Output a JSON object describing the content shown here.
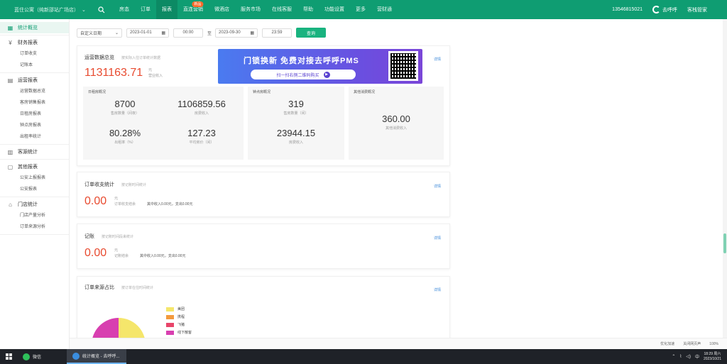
{
  "topbar": {
    "store": "蓝住公寓（纯新邵站广场店）",
    "nav": [
      {
        "label": "房态",
        "active": false,
        "badge": ""
      },
      {
        "label": "订单",
        "active": false,
        "badge": ""
      },
      {
        "label": "报表",
        "active": true,
        "badge": ""
      },
      {
        "label": "直连营销",
        "active": false,
        "badge": "新品"
      },
      {
        "label": "微酒店",
        "active": false,
        "badge": ""
      },
      {
        "label": "服务市场",
        "active": false,
        "badge": ""
      },
      {
        "label": "在线客服",
        "active": false,
        "badge": ""
      },
      {
        "label": "帮助",
        "active": false,
        "badge": ""
      },
      {
        "label": "功能设置",
        "active": false,
        "badge": ""
      },
      {
        "label": "更多",
        "active": false,
        "badge": ""
      },
      {
        "label": "营财通",
        "active": false,
        "badge": ""
      }
    ],
    "phone": "13546815021",
    "brand": "去呼呼",
    "user": "客栈管家"
  },
  "sidebar": {
    "groups": [
      {
        "label": "统计概览",
        "icon": "grid-icon",
        "glyph": "▦",
        "active": true,
        "items": []
      },
      {
        "label": "财务报表",
        "icon": "yen-icon",
        "glyph": "¥",
        "active": false,
        "items": [
          "订单收支",
          "记账本"
        ]
      },
      {
        "label": "运营报表",
        "icon": "chart-icon",
        "glyph": "▤",
        "active": false,
        "items": [
          "运营数据总览",
          "客房销售报表",
          "日租房报表",
          "钟点房报表",
          "出租率统计"
        ]
      },
      {
        "label": "客源统计",
        "icon": "bar-icon",
        "glyph": "▥",
        "active": false,
        "items": []
      },
      {
        "label": "其他报表",
        "icon": "doc-icon",
        "glyph": "▢",
        "active": false,
        "items": [
          "公安上报报表",
          "公安报表"
        ]
      },
      {
        "label": "门店统计",
        "icon": "home-icon",
        "glyph": "⌂",
        "active": false,
        "items": [
          "门店产量分析",
          "订单来源分析"
        ]
      }
    ]
  },
  "filter": {
    "range_option": "自定义日期",
    "start_date": "2023-01-01",
    "start_time": "00:00",
    "separator": "至",
    "end_date": "2023-09-30",
    "end_time": "23:59",
    "query_label": "查询"
  },
  "ops_card": {
    "title": "运营数据总览",
    "hint": "按实际入住订单统计数据",
    "detail": "详情",
    "total": "1131163.71",
    "total_unit": "元",
    "total_label": "营业收入",
    "daily": {
      "title": "日租房概况",
      "metrics": [
        {
          "value": "8700",
          "label": "售房数量（间夜）"
        },
        {
          "value": "1106859.56",
          "label": "房费收入"
        },
        {
          "value": "80.28%",
          "label": "出租率（%）"
        },
        {
          "value": "127.23",
          "label": "平均房价（间）"
        }
      ]
    },
    "hourly": {
      "title": "钟点房概况",
      "metrics": [
        {
          "value": "319",
          "label": "售房数量（间）"
        },
        {
          "value": "23944.15",
          "label": "房费收入"
        }
      ]
    },
    "other": {
      "title": "其他消费概况",
      "metrics": [
        {
          "value": "360.00",
          "label": "其他消费收入"
        }
      ]
    }
  },
  "ad": {
    "title": "门锁换新 免费对接去呼呼PMS",
    "button": "扫一扫右侧二维码购买"
  },
  "order_card": {
    "title": "订单收支统计",
    "hint": "按记账时间统计",
    "detail": "详情",
    "amount": "0.00",
    "unit": "元",
    "label": "订单收支结余",
    "breakdown": "其中收入0.00元，支出0.00元"
  },
  "ledger_card": {
    "title": "记账",
    "hint": "按记账时间段来统计",
    "detail": "详情",
    "amount": "0.00",
    "unit": "元",
    "label": "记账结余",
    "breakdown": "其中收入0.00元，支出0.00元"
  },
  "source_card": {
    "title": "订单来源占比",
    "hint": "按订单在住时间统计",
    "detail": "详情"
  },
  "chart_data": {
    "type": "pie",
    "categories": [
      "美团",
      "携程",
      "飞猪",
      "线下散客"
    ],
    "values": [
      50,
      15,
      12,
      23
    ],
    "colors": [
      "#f5e66b",
      "#f39a3d",
      "#e8456a",
      "#d83fb0"
    ],
    "legend_position": "right"
  },
  "statusbar": {
    "optimize": "优化加速",
    "zoom": "100%",
    "close_sound": "关闭网页声"
  },
  "taskbar": {
    "apps": [
      {
        "label": "微信",
        "color": "#2ec05a",
        "active": false
      },
      {
        "label": "统计概览 - 去呼呼...",
        "color": "#3a8dde",
        "active": true
      }
    ],
    "time": "18:29 周六",
    "date": "2023/10/21",
    "ime": "中"
  }
}
